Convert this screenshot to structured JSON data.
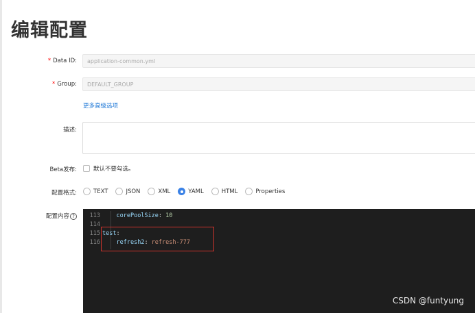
{
  "page_title": "编辑配置",
  "data_id": {
    "label": "Data ID:",
    "required": "*",
    "value": "application-common.yml"
  },
  "group": {
    "label": "Group:",
    "required": "*",
    "value": "DEFAULT_GROUP"
  },
  "advanced_link": "更多高级选项",
  "description": {
    "label": "描述:",
    "value": ""
  },
  "beta": {
    "label": "Beta发布:",
    "checkbox_label": "默认不要勾选。",
    "checked": false
  },
  "format": {
    "label": "配置格式:",
    "options": [
      "TEXT",
      "JSON",
      "XML",
      "YAML",
      "HTML",
      "Properties"
    ],
    "selected": "YAML"
  },
  "content": {
    "label": "配置内容",
    "help": "?",
    "lines": [
      {
        "num": "113",
        "key": "corePoolSize",
        "value": "10"
      },
      {
        "num": "114",
        "key": "",
        "value": ""
      },
      {
        "num": "115",
        "key": "test",
        "value": ""
      },
      {
        "num": "116",
        "key": "refresh2",
        "value": "refresh-777"
      }
    ]
  },
  "watermark": "CSDN @funtyung",
  "colors": {
    "accent": "#3b82e6",
    "link": "#1a75d6",
    "required": "#ff0000",
    "editor_bg": "#1e1e1e",
    "highlight": "#d0342c"
  }
}
